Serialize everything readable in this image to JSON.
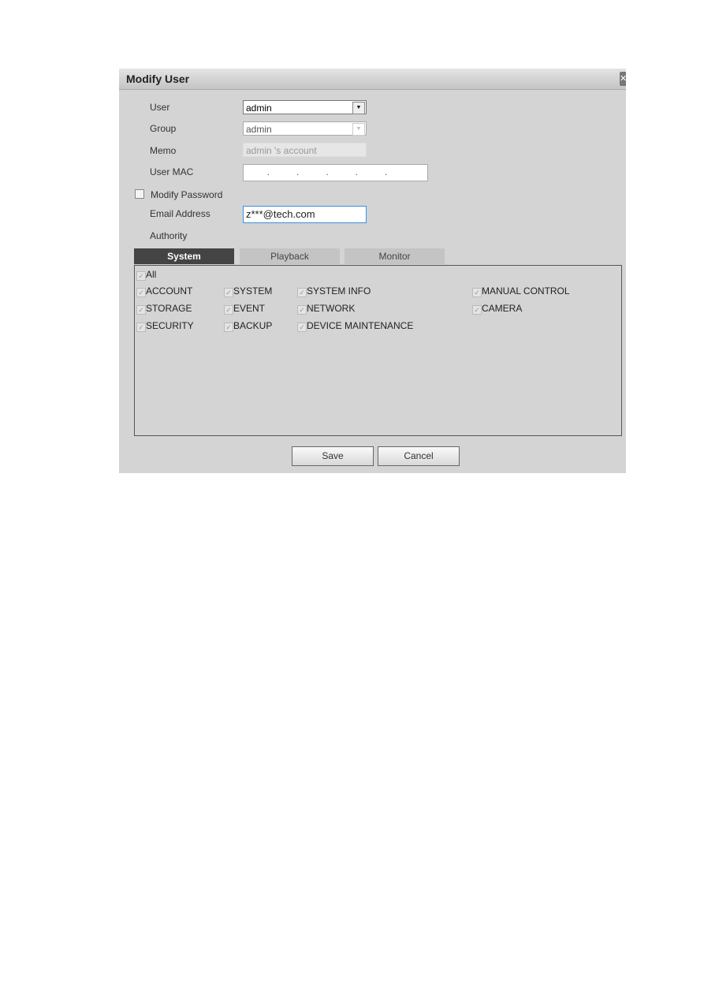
{
  "dialog": {
    "title": "Modify User",
    "close_icon": "close-icon"
  },
  "form": {
    "user_label": "User",
    "user_value": "admin",
    "group_label": "Group",
    "group_value": "admin",
    "memo_label": "Memo",
    "memo_value": "admin 's account",
    "mac_label": "User MAC",
    "mac_value": "     .      .      .      .      .",
    "modify_password_label": "Modify Password",
    "modify_password_checked": false,
    "email_label": "Email Address",
    "email_value": "z***@tech.com",
    "authority_label": "Authority"
  },
  "tabs": [
    {
      "label": "System",
      "active": true
    },
    {
      "label": "Playback"
    },
    {
      "label": "Monitor"
    }
  ],
  "permissions": {
    "all": "All",
    "items": [
      "ACCOUNT",
      "SYSTEM",
      "SYSTEM INFO",
      "MANUAL CONTROL",
      "STORAGE",
      "EVENT",
      "NETWORK",
      "CAMERA",
      "SECURITY",
      "BACKUP",
      "DEVICE MAINTENANCE"
    ],
    "all_checked": true
  },
  "buttons": {
    "save": "Save",
    "cancel": "Cancel"
  }
}
